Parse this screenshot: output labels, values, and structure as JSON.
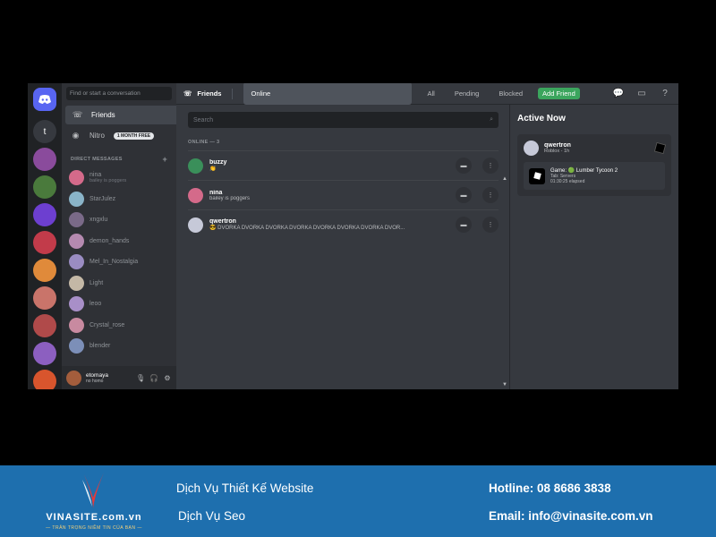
{
  "colors": {
    "blurple": "#5865f2",
    "green": "#3ba55d",
    "footer_bg": "#1e6fae",
    "bg_primary": "#36393f",
    "bg_secondary": "#2f3136",
    "bg_tertiary": "#202225"
  },
  "rail": {
    "home_icon": "discord-logo-icon",
    "servers": [
      {
        "label": "t",
        "color": "#36393f"
      },
      {
        "label": "",
        "color": "#8a4b9c"
      },
      {
        "label": "",
        "color": "#4a7a3c"
      },
      {
        "label": "",
        "color": "#6d3fd0"
      },
      {
        "label": "",
        "color": "#c23b4a"
      },
      {
        "label": "",
        "color": "#e08a3a"
      },
      {
        "label": "",
        "color": "#c9746a"
      },
      {
        "label": "",
        "color": "#b04a4a"
      },
      {
        "label": "",
        "color": "#8c5fc0"
      },
      {
        "label": "",
        "color": "#d8552d"
      }
    ]
  },
  "dms": {
    "search_placeholder": "Find or start a conversation",
    "friends_label": "Friends",
    "nitro_label": "Nitro",
    "nitro_badge": "1 MONTH FREE",
    "section_label": "DIRECT MESSAGES",
    "items": [
      {
        "name": "nina",
        "status": "bailey is poggers",
        "color": "#d46a8a"
      },
      {
        "name": "StarJulez",
        "status": "",
        "color": "#8ab4c8"
      },
      {
        "name": "xngxlu",
        "status": "",
        "color": "#7a6a88"
      },
      {
        "name": "demon_hands",
        "status": "",
        "color": "#b58ab0"
      },
      {
        "name": "Mel_In_Nostalgia",
        "status": "",
        "color": "#9a8cc2"
      },
      {
        "name": "Light",
        "status": "",
        "color": "#c4b8a6"
      },
      {
        "name": "leoo",
        "status": "",
        "color": "#a88fc8"
      },
      {
        "name": "Crystal_rose",
        "status": "",
        "color": "#c88aa0"
      },
      {
        "name": "blender",
        "status": "",
        "color": "#7c8fb8"
      }
    ],
    "user": {
      "name": "etomaya",
      "status": "no homo"
    }
  },
  "topbar": {
    "title": "Friends",
    "tabs": [
      "Online",
      "All",
      "Pending",
      "Blocked"
    ],
    "add_friend": "Add Friend"
  },
  "friends": {
    "search_placeholder": "Search",
    "online_header": "ONLINE — 3",
    "rows": [
      {
        "name": "buzzy",
        "status": "👏",
        "color": "#3a8f5a"
      },
      {
        "name": "nina",
        "status": "bailey is poggers",
        "color": "#d46a8a"
      },
      {
        "name": "qwertron",
        "status": "😎 DVORKA DVORKA DVORKA DVORKA DVORKA DVORKA DVORKA DVOR...",
        "color": "#c6c9d8"
      }
    ]
  },
  "active_now": {
    "title": "Active Now",
    "user": "qwertron",
    "user_status": "Roblox - 1h",
    "game_title": "Game: 🟢 Lumber Tycoon 2",
    "game_tab": "Tab: Servers",
    "game_elapsed": "01:30:25 elapsed"
  },
  "footer": {
    "brand": "VINASITE.com.vn",
    "slogan": "— TRẢN TRỌNG NIỀM TIN CỦA BẠN —",
    "service1": "Dịch Vụ Thiết Kế Website",
    "service2": "Dịch Vụ Seo",
    "hotline": "Hotline: 08 8686 3838",
    "email": "Email: info@vinasite.com.vn"
  }
}
